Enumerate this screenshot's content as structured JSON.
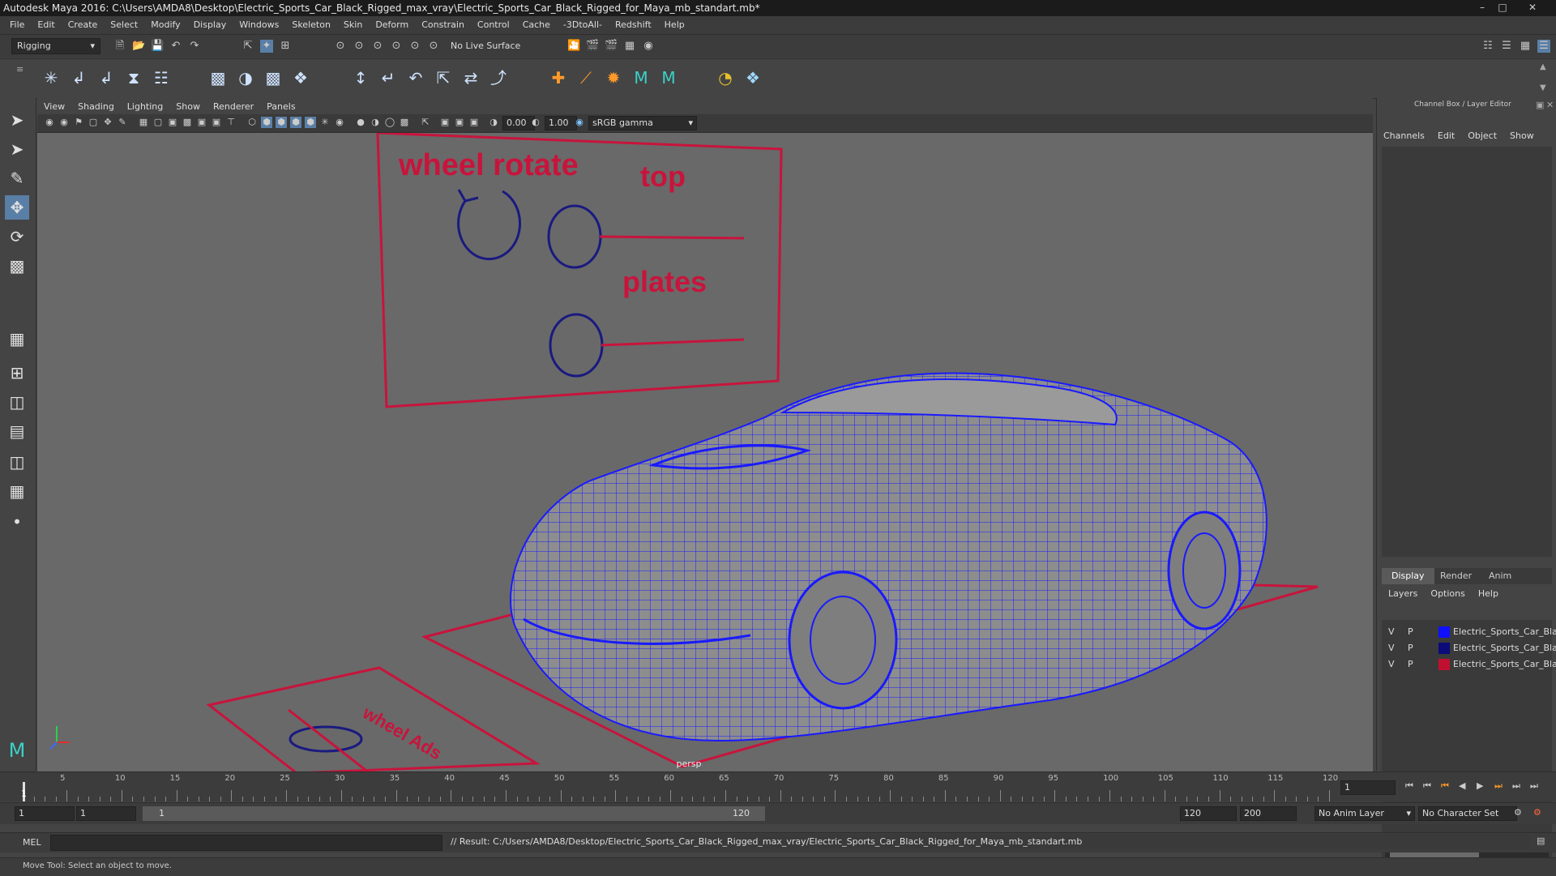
{
  "window": {
    "title": "Autodesk Maya 2016: C:\\Users\\AMDA8\\Desktop\\Electric_Sports_Car_Black_Rigged_max_vray\\Electric_Sports_Car_Black_Rigged_for_Maya_mb_standart.mb*"
  },
  "menubar": [
    "File",
    "Edit",
    "Create",
    "Select",
    "Modify",
    "Display",
    "Windows",
    "Skeleton",
    "Skin",
    "Deform",
    "Constrain",
    "Control",
    "Cache",
    "-3DtoAll-",
    "Redshift",
    "Help"
  ],
  "statusline": {
    "mode": "Rigging",
    "live_surface": "No Live Surface"
  },
  "panel_menu": [
    "View",
    "Shading",
    "Lighting",
    "Show",
    "Renderer",
    "Panels"
  ],
  "panel_toolbar": {
    "exposure": "0.00",
    "gamma": "1.00",
    "colorspace": "sRGB gamma"
  },
  "viewport": {
    "camera_label": "persp",
    "board": {
      "title": "wheel rotate",
      "top_label": "top",
      "plates_label": "plates"
    },
    "floor_text": "wheel Ads"
  },
  "right_panel": {
    "header": "Channel Box / Layer Editor",
    "channel_menu": [
      "Channels",
      "Edit",
      "Object",
      "Show"
    ],
    "tabs": [
      "Display",
      "Render",
      "Anim"
    ],
    "layer_menu": [
      "Layers",
      "Options",
      "Help"
    ],
    "layers": [
      {
        "v": "V",
        "p": "P",
        "name": "Electric_Sports_Car_Bla",
        "color": "#1010ff"
      },
      {
        "v": "V",
        "p": "P",
        "name": "Electric_Sports_Car_Bla",
        "color": "#0b0b7a"
      },
      {
        "v": "V",
        "p": "P",
        "name": "Electric_Sports_Car_Bla",
        "color": "#c01030"
      }
    ]
  },
  "timeline": {
    "ticks": [
      "5",
      "10",
      "15",
      "20",
      "25",
      "30",
      "35",
      "40",
      "45",
      "50",
      "55",
      "60",
      "65",
      "70",
      "75",
      "80",
      "85",
      "90",
      "95",
      "100",
      "105",
      "110",
      "115",
      "120"
    ],
    "start_tick": "1",
    "current_frame": "1"
  },
  "range": {
    "start": "1",
    "start2": "1",
    "slider_start": "1",
    "slider_end": "120",
    "end": "120",
    "end2": "200",
    "anim_layer": "No Anim Layer",
    "char_set": "No Character Set"
  },
  "cmdline": {
    "lang": "MEL",
    "result": "// Result: C:/Users/AMDA8/Desktop/Electric_Sports_Car_Black_Rigged_max_vray/Electric_Sports_Car_Black_Rigged_for_Maya_mb_standart.mb"
  },
  "helpline": {
    "text": "Move Tool: Select an object to move."
  },
  "colors": {
    "wire": "#1a1aff",
    "control": "#c8143c",
    "board_circle": "#1a1a80"
  }
}
